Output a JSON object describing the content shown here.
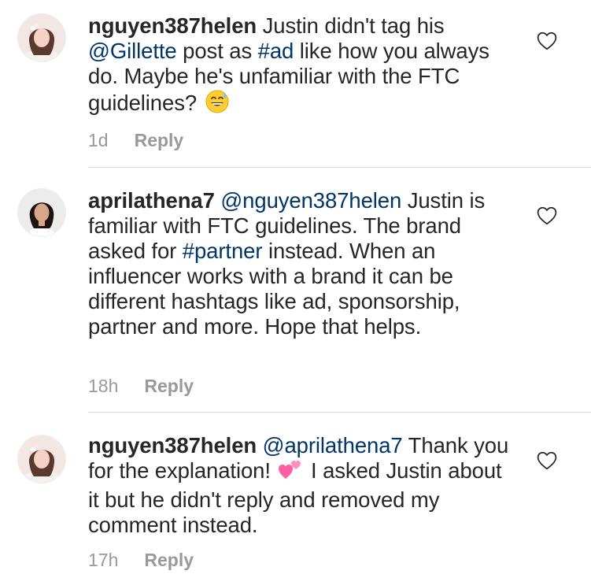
{
  "comments": [
    {
      "username": "nguyen387helen",
      "segments": [
        {
          "t": "text",
          "v": " Justin didn't tag his "
        },
        {
          "t": "mention",
          "v": "@Gillette"
        },
        {
          "t": "text",
          "v": " post as "
        },
        {
          "t": "hashtag",
          "v": "#ad"
        },
        {
          "t": "text",
          "v": " like how you always do. Maybe he's unfamiliar with the FTC guidelines? "
        },
        {
          "t": "emoji",
          "v": "sweat-smile-emoji"
        }
      ],
      "time": "1d",
      "reply_label": "Reply",
      "avatar": "avatar-helen"
    },
    {
      "username": "aprilathena7",
      "segments": [
        {
          "t": "text",
          "v": " "
        },
        {
          "t": "mention",
          "v": "@nguyen387helen"
        },
        {
          "t": "text",
          "v": " Justin is familiar with FTC guidelines. The brand asked for "
        },
        {
          "t": "hashtag",
          "v": "#partner"
        },
        {
          "t": "text",
          "v": " instead. When an influencer works with a brand it can be different hashtags like ad, sponsorship, partner and more. Hope that helps."
        }
      ],
      "time": "18h",
      "reply_label": "Reply",
      "avatar": "avatar-april"
    },
    {
      "username": "nguyen387helen",
      "segments": [
        {
          "t": "text",
          "v": " "
        },
        {
          "t": "mention",
          "v": "@aprilathena7"
        },
        {
          "t": "text",
          "v": " Thank you for the explanation! "
        },
        {
          "t": "emoji",
          "v": "two-hearts-emoji"
        },
        {
          "t": "text",
          "v": " I asked Justin about it but he didn't reply and removed my comment instead."
        }
      ],
      "time": "17h",
      "reply_label": "Reply",
      "avatar": "avatar-helen"
    }
  ],
  "colors": {
    "text": "#262626",
    "link": "#003569",
    "meta": "#999999",
    "divider": "#dbdbdb"
  },
  "icons": {
    "like": "heart-outline-icon"
  }
}
